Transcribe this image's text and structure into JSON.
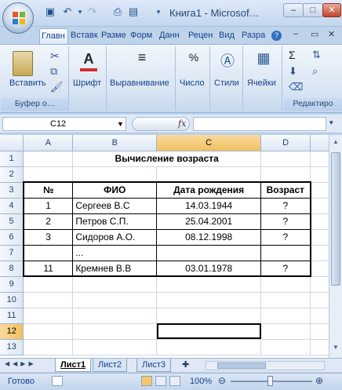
{
  "window": {
    "title": "Книга1 - Microsof…"
  },
  "qat": {
    "save_icon": "save-icon",
    "undo_icon": "undo-icon",
    "redo_icon": "redo-icon"
  },
  "tabs": [
    "Главн",
    "Вставк",
    "Разме",
    "Форм",
    "Данн",
    "Рецен",
    "Вид",
    "Разра"
  ],
  "ribbon": {
    "paste": "Вставить",
    "clipboard_label": "Буфер о…",
    "font": "Шрифт",
    "align": "Выравнивание",
    "number": "Число",
    "number_symbol": "%",
    "styles": "Стили",
    "cells": "Ячейки",
    "editing_label": "Редактиро",
    "sigma": "Σ"
  },
  "formula_bar": {
    "name_box": "C12",
    "fx": "fx",
    "value": ""
  },
  "columns": [
    "A",
    "B",
    "C",
    "D"
  ],
  "rows": [
    {
      "n": "1",
      "A": "",
      "B": "Вычисление возраста",
      "C": "",
      "D": ""
    },
    {
      "n": "2",
      "A": "",
      "B": "",
      "C": "",
      "D": ""
    },
    {
      "n": "3",
      "A": "№",
      "B": "ФИО",
      "C": "Дата рождения",
      "D": "Возраст"
    },
    {
      "n": "4",
      "A": "1",
      "B": "Сергеев В.С",
      "C": "14.03.1944",
      "D": "?"
    },
    {
      "n": "5",
      "A": "2",
      "B": "Петров С.П.",
      "C": "25.04.2001",
      "D": "?"
    },
    {
      "n": "6",
      "A": "3",
      "B": "Сидоров А.О.",
      "C": "08.12.1998",
      "D": "?"
    },
    {
      "n": "7",
      "A": "",
      "B": "...",
      "C": "",
      "D": ""
    },
    {
      "n": "8",
      "A": "11",
      "B": "Кремнев В.В",
      "C": "03.01.1978",
      "D": "?"
    },
    {
      "n": "9",
      "A": "",
      "B": "",
      "C": "",
      "D": ""
    },
    {
      "n": "10",
      "A": "",
      "B": "",
      "C": "",
      "D": ""
    },
    {
      "n": "11",
      "A": "",
      "B": "",
      "C": "",
      "D": ""
    },
    {
      "n": "12",
      "A": "",
      "B": "",
      "C": "",
      "D": ""
    },
    {
      "n": "13",
      "A": "",
      "B": "",
      "C": "",
      "D": ""
    }
  ],
  "sheets": [
    "Лист1",
    "Лист2",
    "Лист3"
  ],
  "status": {
    "ready": "Готово",
    "zoom": "100%"
  }
}
